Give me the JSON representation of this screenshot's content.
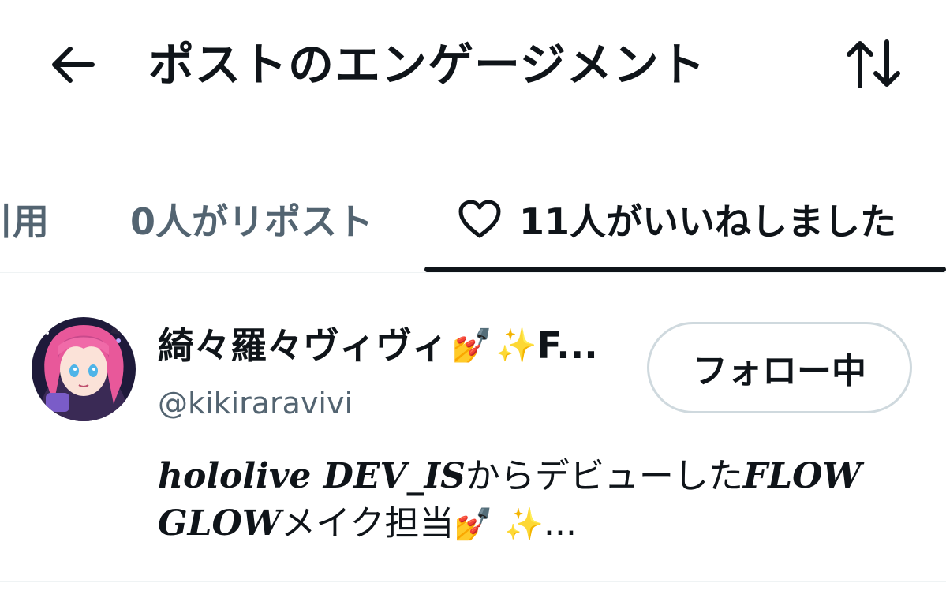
{
  "header": {
    "title": "ポストのエンゲージメント",
    "back_icon": "arrow-left-icon",
    "sort_icon": "sort-arrows-icon"
  },
  "tabs": [
    {
      "label": "引用",
      "active": false
    },
    {
      "label": "0人がリポスト",
      "active": false
    },
    {
      "label": "11人がいいねしました",
      "active": true,
      "icon": "heart-icon"
    }
  ],
  "user": {
    "display_name": "綺々羅々ヴィヴィ",
    "name_emoji_1": "💅",
    "name_emoji_2": "✨",
    "name_truncated": "F...",
    "handle": "@kikiraravivi",
    "follow_label": "フォロー中",
    "bio": {
      "part1": "hololive DEV_IS",
      "part2": "からデビューした",
      "part3": "FLOW GLOW",
      "part4": "メイク担当",
      "emoji_1": "💅",
      "emoji_2": "✨",
      "ellipsis": "..."
    }
  },
  "colors": {
    "text_primary": "#0f1419",
    "text_secondary": "#536471",
    "divider": "#eff3f4",
    "button_border": "#cfd9de",
    "avatar_hair": "#e8589a"
  }
}
